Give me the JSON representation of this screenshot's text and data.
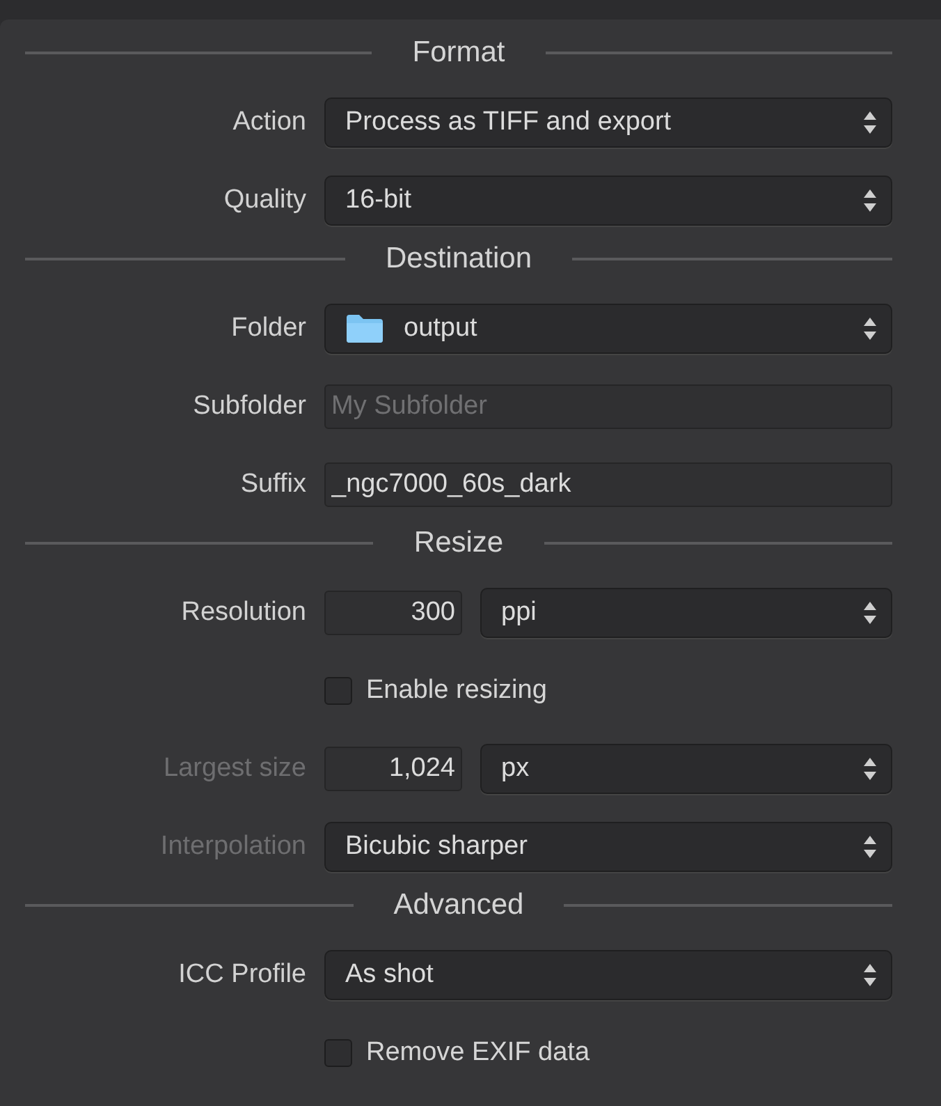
{
  "sections": [
    {
      "title": "Format",
      "rows": [
        {
          "kind": "select",
          "label": "Action",
          "value": "Process as TIFF and export",
          "disabled": false
        },
        {
          "kind": "select",
          "label": "Quality",
          "value": "16-bit",
          "disabled": false
        }
      ]
    },
    {
      "title": "Destination",
      "rows": [
        {
          "kind": "folder-select",
          "label": "Folder",
          "value": "output",
          "disabled": false
        },
        {
          "kind": "field",
          "label": "Subfolder",
          "placeholder": "My Subfolder",
          "disabled": false
        },
        {
          "kind": "field",
          "label": "Suffix",
          "value": "_ngc7000_60s_dark",
          "disabled": false
        }
      ]
    },
    {
      "title": "Resize",
      "rows": [
        {
          "kind": "number-select",
          "label": "Resolution",
          "number": "300",
          "value": "ppi",
          "disabled": false
        },
        {
          "kind": "checkbox",
          "label": "Enable resizing",
          "checked": false
        },
        {
          "kind": "number-select",
          "label": "Largest size",
          "number": "1,024",
          "value": "px",
          "disabled": true
        },
        {
          "kind": "select",
          "label": "Interpolation",
          "value": "Bicubic sharper",
          "disabled": true
        }
      ]
    },
    {
      "title": "Advanced",
      "rows": [
        {
          "kind": "select",
          "label": "ICC Profile",
          "value": "As shot",
          "disabled": false
        },
        {
          "kind": "checkbox",
          "label": "Remove EXIF data",
          "checked": false
        }
      ]
    }
  ]
}
